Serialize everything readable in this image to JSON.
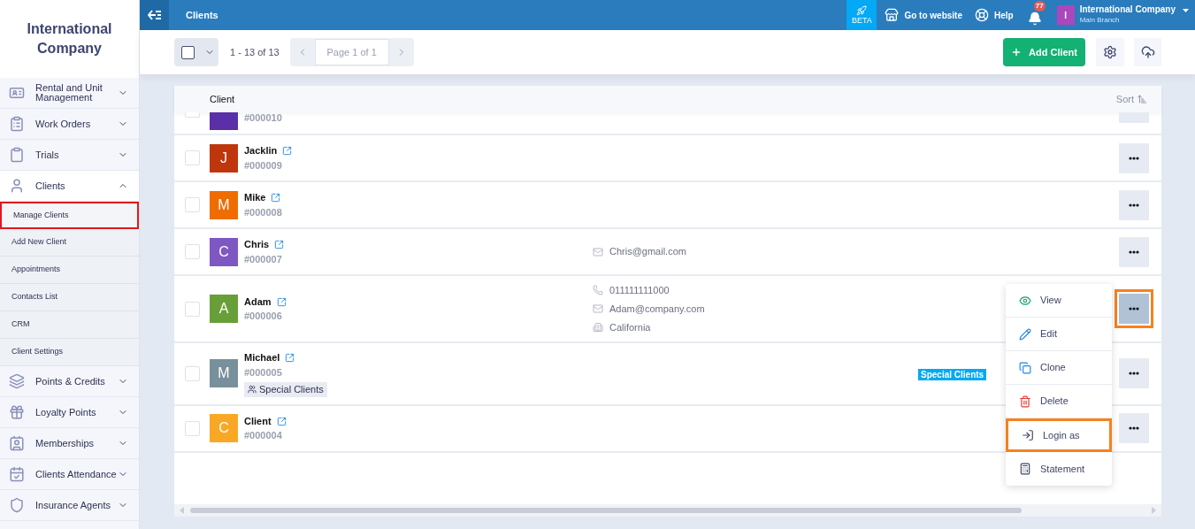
{
  "sidebar": {
    "brand": "International Company",
    "items": [
      {
        "label": "Rental and Unit Management",
        "kind": "rental",
        "expanded": false
      },
      {
        "label": "Work Orders",
        "kind": "orders",
        "expanded": false
      },
      {
        "label": "Trials",
        "kind": "trials",
        "expanded": false
      },
      {
        "label": "Clients",
        "kind": "clients",
        "expanded": true,
        "children": [
          {
            "label": "Manage Clients",
            "selected": true
          },
          {
            "label": "Add New Client",
            "selected": false
          },
          {
            "label": "Appointments",
            "selected": false
          },
          {
            "label": "Contacts List",
            "selected": false
          },
          {
            "label": "CRM",
            "selected": false
          },
          {
            "label": "Client Settings",
            "selected": false
          }
        ]
      },
      {
        "label": "Points & Credits",
        "kind": "points",
        "expanded": false
      },
      {
        "label": "Loyalty Points",
        "kind": "loyalty",
        "expanded": false
      },
      {
        "label": "Memberships",
        "kind": "memberships",
        "expanded": false
      },
      {
        "label": "Clients Attendance",
        "kind": "attendance",
        "expanded": false
      },
      {
        "label": "Insurance Agents",
        "kind": "insurance",
        "expanded": false
      }
    ]
  },
  "topbar": {
    "title": "Clients",
    "beta": "BETA",
    "website": "Go to website",
    "help": "Help",
    "notifications": "77",
    "account": {
      "initial": "I",
      "name": "International Company",
      "branch": "Main Branch"
    }
  },
  "toolbar": {
    "select_all_checked": false,
    "range": "1 - 13 of 13",
    "page": "Page 1 of 1",
    "add_button": "Add Client"
  },
  "table": {
    "column": "Client",
    "sort": "Sort",
    "rows": [
      {
        "checked": false,
        "code": "#000010",
        "color": "#5b2fa8",
        "menu_open": false
      },
      {
        "checked": false,
        "name": "Jacklin",
        "initial": "J",
        "code": "#000009",
        "color": "#bf360c",
        "menu_open": false
      },
      {
        "checked": false,
        "name": "Mike",
        "initial": "M",
        "code": "#000008",
        "color": "#ef6c00",
        "menu_open": false
      },
      {
        "checked": false,
        "name": "Chris",
        "initial": "C",
        "code": "#000007",
        "color": "#7e57c2",
        "menu_open": false,
        "contacts": [
          {
            "kind": "email",
            "text": "Chris@gmail.com"
          }
        ]
      },
      {
        "checked": false,
        "name": "Adam",
        "initial": "A",
        "code": "#000006",
        "color": "#689f38",
        "menu_open": true,
        "contacts": [
          {
            "kind": "phone",
            "text": "011111111000"
          },
          {
            "kind": "email",
            "text": "Adam@company.com"
          },
          {
            "kind": "address",
            "text": "California"
          }
        ]
      },
      {
        "checked": false,
        "name": "Michael",
        "initial": "M",
        "code": "#000005",
        "color": "#78909c",
        "menu_open": false,
        "group": "Special Clients",
        "tag": "Special Clients"
      },
      {
        "checked": false,
        "name": "Client",
        "initial": "C",
        "code": "#000004",
        "color": "#f9a825",
        "menu_open": false
      }
    ]
  },
  "menu": {
    "items": [
      {
        "label": "View",
        "kind": "view",
        "selected": false
      },
      {
        "label": "Edit",
        "kind": "edit",
        "selected": false
      },
      {
        "label": "Clone",
        "kind": "clone",
        "selected": false
      },
      {
        "label": "Delete",
        "kind": "delete",
        "selected": false
      },
      {
        "label": "Login as",
        "kind": "login",
        "selected": true
      },
      {
        "label": "Statement",
        "kind": "statement",
        "selected": false
      }
    ]
  }
}
